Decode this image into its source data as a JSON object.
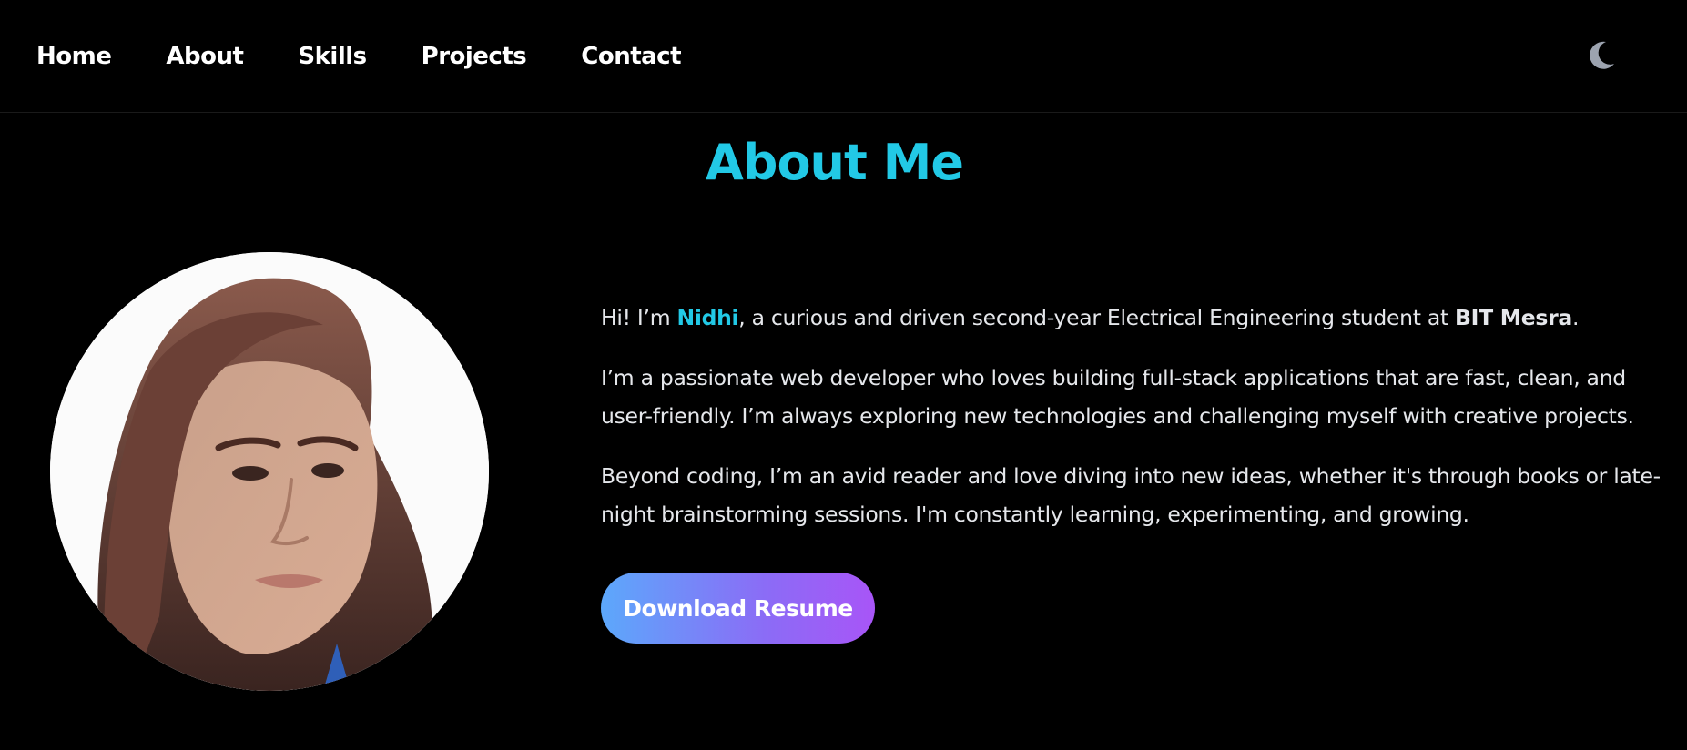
{
  "nav": {
    "items": [
      {
        "label": "Home"
      },
      {
        "label": "About"
      },
      {
        "label": "Skills"
      },
      {
        "label": "Projects"
      },
      {
        "label": "Contact"
      }
    ],
    "theme_icon": "moon-icon"
  },
  "about": {
    "title": "About Me",
    "photo": "profile-photo",
    "para1": {
      "before": "Hi! I’m ",
      "name": "Nidhi",
      "middle": ", a curious and driven second-year Electrical Engineering student at ",
      "college": "BIT Mesra",
      "after": "."
    },
    "para2": "I’m a passionate web developer who loves building full-stack applications that are fast, clean, and user-friendly. I’m always exploring new technologies and challenging myself with creative projects.",
    "para3": "Beyond coding, I’m an avid reader and love diving into new ideas, whether it's through books or late-night brainstorming sessions. I'm constantly learning, experimenting, and growing.",
    "button_label": "Download Resume"
  },
  "colors": {
    "background": "#000000",
    "accent": "#22c9e6",
    "text": "#e5e7eb",
    "button_gradient_start": "#5ca8fb",
    "button_gradient_end": "#a855f7",
    "icon": "#9ca3af"
  }
}
